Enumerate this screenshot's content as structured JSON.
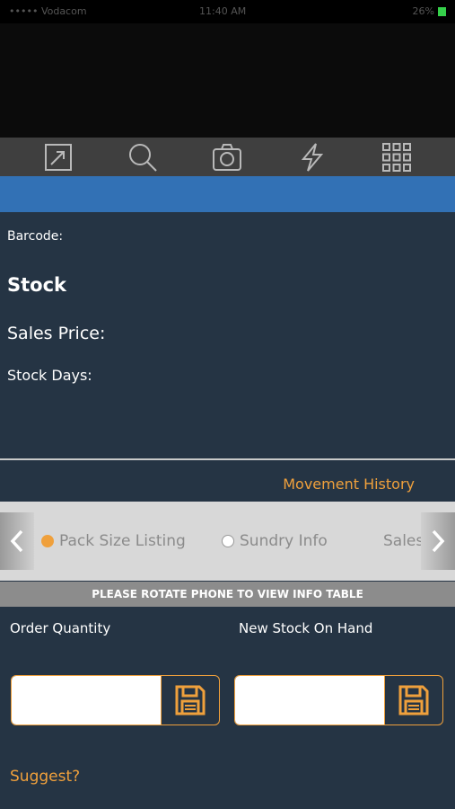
{
  "status_bar": {
    "carrier": "•••••  Vodacom  ",
    "time": "11:40 AM",
    "battery": "26%"
  },
  "toolbar": {
    "icons": [
      "expand-icon",
      "search-icon",
      "camera-icon",
      "flash-icon",
      "grid-menu-icon"
    ],
    "icon_color": "#b9b9b9"
  },
  "colors": {
    "background": "#253444",
    "accent": "#efa03c",
    "blue_bar": "#3271b5"
  },
  "info": {
    "barcode_label": "Barcode:",
    "stock_title": "Stock",
    "sales_price_label": "Sales Price:",
    "stock_days_label": "Stock Days:"
  },
  "movement_history": "Movement History",
  "tabs": [
    {
      "label": "Pack Size Listing",
      "selected": true
    },
    {
      "label": "Sundry Info",
      "selected": false
    },
    {
      "label": "Sales His",
      "selected": false
    }
  ],
  "rotate_banner": "PLEASE ROTATE PHONE TO VIEW INFO TABLE",
  "order_quantity": {
    "label": "Order Quantity",
    "value": ""
  },
  "new_stock": {
    "label": "New Stock On Hand",
    "value": ""
  },
  "suggest_label": "Suggest?"
}
